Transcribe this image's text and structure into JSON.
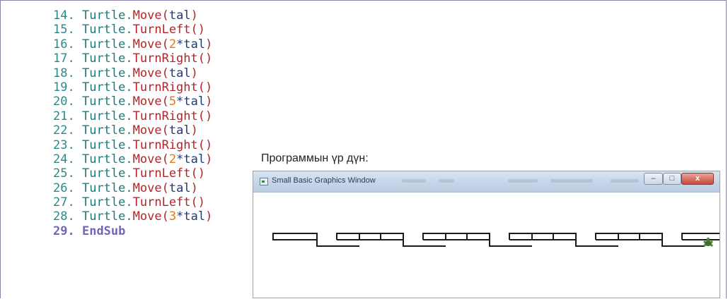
{
  "code_lines": [
    {
      "num": "14.",
      "obj": "Turtle",
      "dot": ".",
      "method": "Move",
      "open": "(",
      "lit": "",
      "star": "",
      "arg": "tal",
      "close": ")"
    },
    {
      "num": "15.",
      "obj": "Turtle",
      "dot": ".",
      "method": "TurnLeft",
      "open": "()",
      "lit": "",
      "star": "",
      "arg": "",
      "close": ""
    },
    {
      "num": "16.",
      "obj": "Turtle",
      "dot": ".",
      "method": "Move",
      "open": "(",
      "lit": "2",
      "star": "*",
      "arg": "tal",
      "close": ")"
    },
    {
      "num": "17.",
      "obj": "Turtle",
      "dot": ".",
      "method": "TurnRight",
      "open": "()",
      "lit": "",
      "star": "",
      "arg": "",
      "close": ""
    },
    {
      "num": "18.",
      "obj": "Turtle",
      "dot": ".",
      "method": "Move",
      "open": "(",
      "lit": "",
      "star": "",
      "arg": "tal",
      "close": ")"
    },
    {
      "num": "19.",
      "obj": "Turtle",
      "dot": ".",
      "method": "TurnRight",
      "open": "()",
      "lit": "",
      "star": "",
      "arg": "",
      "close": ""
    },
    {
      "num": "20.",
      "obj": "Turtle",
      "dot": ".",
      "method": "Move",
      "open": "(",
      "lit": "5",
      "star": "*",
      "arg": "tal",
      "close": ")"
    },
    {
      "num": "21.",
      "obj": "Turtle",
      "dot": ".",
      "method": "TurnRight",
      "open": "()",
      "lit": "",
      "star": "",
      "arg": "",
      "close": ""
    },
    {
      "num": "22.",
      "obj": "Turtle",
      "dot": ".",
      "method": "Move",
      "open": "(",
      "lit": "",
      "star": "",
      "arg": "tal",
      "close": ")"
    },
    {
      "num": "23.",
      "obj": "Turtle",
      "dot": ".",
      "method": "TurnRight",
      "open": "()",
      "lit": "",
      "star": "",
      "arg": "",
      "close": ""
    },
    {
      "num": "24.",
      "obj": "Turtle",
      "dot": ".",
      "method": "Move",
      "open": "(",
      "lit": "2",
      "star": "*",
      "arg": "tal",
      "close": ")"
    },
    {
      "num": "25.",
      "obj": "Turtle",
      "dot": ".",
      "method": "TurnLeft",
      "open": "()",
      "lit": "",
      "star": "",
      "arg": "",
      "close": ""
    },
    {
      "num": "26.",
      "obj": "Turtle",
      "dot": ".",
      "method": "Move",
      "open": "(",
      "lit": "",
      "star": "",
      "arg": "tal",
      "close": ")"
    },
    {
      "num": "27.",
      "obj": "Turtle",
      "dot": ".",
      "method": "TurnLeft",
      "open": "()",
      "lit": "",
      "star": "",
      "arg": "",
      "close": ""
    },
    {
      "num": "28.",
      "obj": "Turtle",
      "dot": ".",
      "method": "Move",
      "open": "(",
      "lit": "3",
      "star": "*",
      "arg": "tal",
      "close": ")"
    }
  ],
  "end_line": {
    "num": "29.",
    "keyword": "EndSub"
  },
  "result_label": "Программын үр дүн:",
  "graphics_window": {
    "title": "Small Basic Graphics Window",
    "minimize_glyph": "–",
    "maximize_glyph": "□",
    "close_glyph": "x",
    "pattern_units": 5,
    "line_color": "#1a1a1a",
    "turtle_icon": "turtle-icon"
  },
  "colors": {
    "line_number": "#2a8a8a",
    "object": "#1f7a7a",
    "method": "#b0262a",
    "literal": "#e07a1a",
    "keyword": "#6f66b8"
  }
}
